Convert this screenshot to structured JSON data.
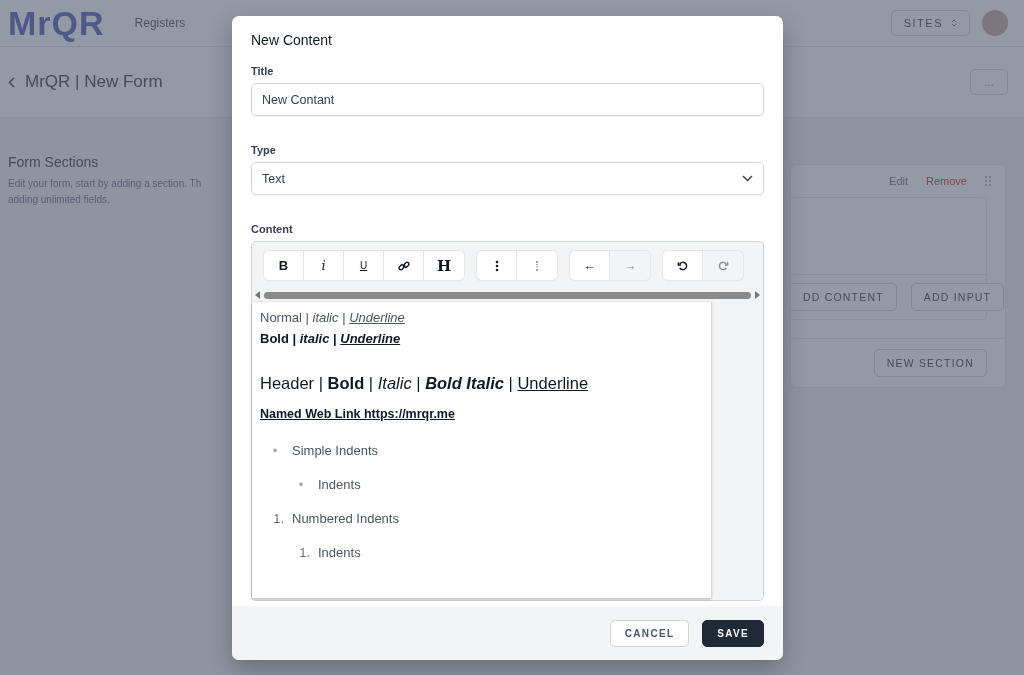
{
  "app_header": {
    "logo": "MrQR",
    "nav": [
      "Registers"
    ],
    "sites_button": "SITES"
  },
  "page_header": {
    "title": "MrQR | New Form",
    "more_button": "..."
  },
  "form_sections": {
    "title": "Form Sections",
    "description_lines": [
      "Edit your form, start by adding a section. Th",
      "adding unlimited fields."
    ]
  },
  "section_card": {
    "edit_link": "Edit",
    "remove_link": "Remove",
    "add_content_button": "DD CONTENT",
    "add_input_button": "ADD INPUT",
    "new_section_button": "NEW SECTION"
  },
  "dialog": {
    "title": "New Content",
    "title_field": {
      "label": "Title",
      "value": "New Contant"
    },
    "type_field": {
      "label": "Type",
      "value": "Text"
    },
    "content_label": "Content",
    "toolbar": [
      {
        "buttons": [
          {
            "kind": "bold",
            "label": "B",
            "disabled": false
          },
          {
            "kind": "italic",
            "label": "i",
            "disabled": false
          },
          {
            "kind": "underline",
            "label": "U",
            "disabled": false
          },
          {
            "kind": "link",
            "disabled": false
          },
          {
            "kind": "heading",
            "label": "H",
            "disabled": false
          }
        ]
      },
      {
        "buttons": [
          {
            "kind": "bullets",
            "disabled": false
          },
          {
            "kind": "numbers",
            "disabled": false
          }
        ]
      },
      {
        "buttons": [
          {
            "kind": "outdent",
            "label": "←",
            "disabled": false
          },
          {
            "kind": "indent",
            "label": "→",
            "disabled": true
          }
        ]
      },
      {
        "buttons": [
          {
            "kind": "undo",
            "disabled": false
          },
          {
            "kind": "redo",
            "disabled": true
          }
        ]
      }
    ],
    "content": [
      {
        "kind": "paragraph",
        "segments": [
          {
            "text": "Normal | "
          },
          {
            "text": "italic",
            "italic": true
          },
          {
            "text": " | "
          },
          {
            "text": "Underline",
            "italic": true,
            "underline": true
          }
        ]
      },
      {
        "kind": "paragraph",
        "segments": [
          {
            "text": "Bold | ",
            "bold": true
          },
          {
            "text": "italic",
            "bold": true,
            "italic": true
          },
          {
            "text": " | ",
            "bold": true
          },
          {
            "text": "Underline",
            "bold": true,
            "italic": true,
            "underline": true
          }
        ]
      },
      {
        "kind": "heading",
        "segments": [
          {
            "text": "Header | "
          },
          {
            "text": "Bold",
            "bold": true
          },
          {
            "text": " | "
          },
          {
            "text": "Italic",
            "italic": true
          },
          {
            "text": " | "
          },
          {
            "text": "Bold Italic",
            "bold": true,
            "italic": true
          },
          {
            "text": " | "
          },
          {
            "text": "Underline",
            "underline": true
          }
        ]
      },
      {
        "kind": "link",
        "segments": [
          {
            "text": "Named Web Link https://mrqr.me",
            "bold": true,
            "underline": true
          }
        ]
      },
      {
        "kind": "bullet_list",
        "items": [
          {
            "marker": "•",
            "text": "Simple Indents",
            "children": [
              {
                "marker": "•",
                "text": "Indents"
              }
            ]
          }
        ]
      },
      {
        "kind": "numbered_list",
        "items": [
          {
            "marker": "1.",
            "text": "Numbered Indents",
            "children": [
              {
                "marker": "1.",
                "text": "Indents"
              }
            ]
          }
        ]
      }
    ],
    "buttons": [
      {
        "kind": "secondary",
        "label": "CANCEL"
      },
      {
        "kind": "primary",
        "label": "SAVE"
      }
    ]
  }
}
